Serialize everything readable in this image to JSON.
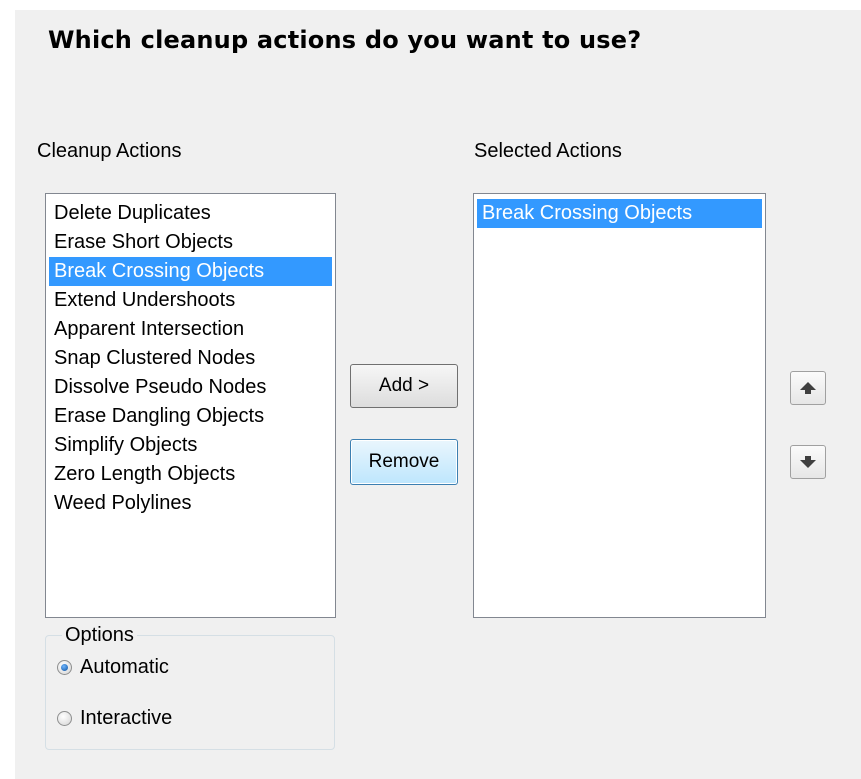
{
  "heading": "Which cleanup actions do you want to use?",
  "cleanup_actions": {
    "label": "Cleanup Actions",
    "items": [
      "Delete Duplicates",
      "Erase Short Objects",
      "Break Crossing Objects",
      "Extend Undershoots",
      "Apparent Intersection",
      "Snap Clustered Nodes",
      "Dissolve Pseudo Nodes",
      "Erase Dangling Objects",
      "Simplify Objects",
      "Zero Length Objects",
      "Weed Polylines"
    ],
    "selected": "Break Crossing Objects"
  },
  "selected_actions": {
    "label": "Selected Actions",
    "items": [
      "Break Crossing Objects"
    ],
    "selected": "Break Crossing Objects"
  },
  "buttons": {
    "add": "Add >",
    "remove": "Remove",
    "move_up_icon": "arrow-up-icon",
    "move_down_icon": "arrow-down-icon"
  },
  "options": {
    "legend": "Options",
    "automatic": "Automatic",
    "interactive": "Interactive",
    "selected": "Automatic"
  },
  "colors": {
    "selection": "#3399ff",
    "panel": "#f0f0f0"
  }
}
